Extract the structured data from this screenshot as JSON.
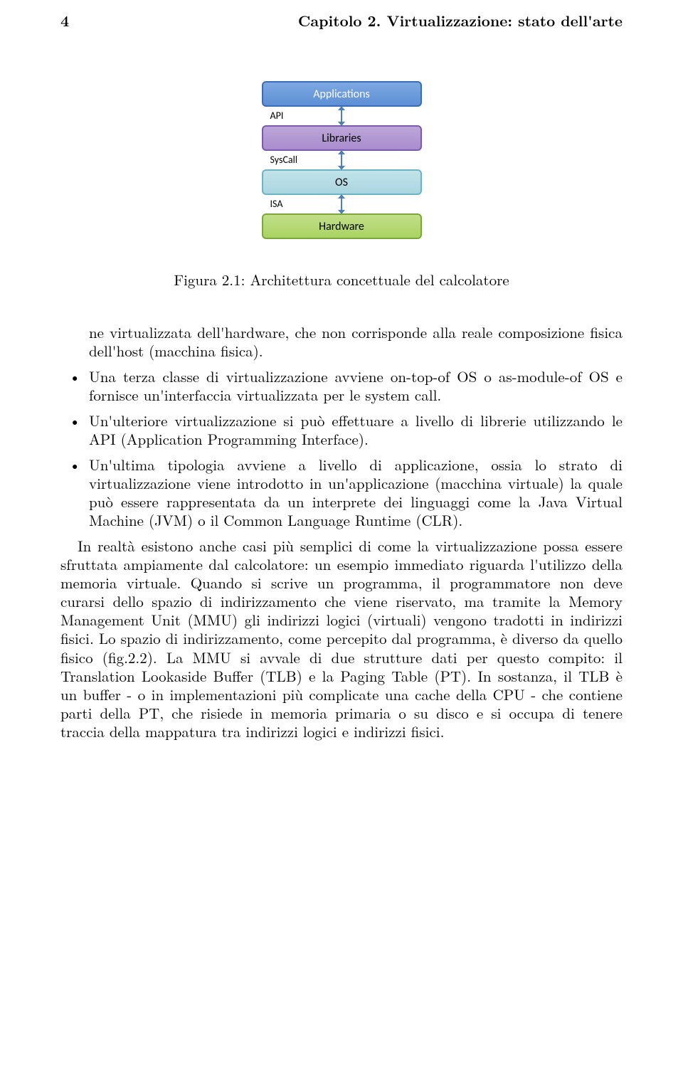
{
  "header": {
    "page_number": "4",
    "running_title": "Capitolo 2. Virtualizzazione: stato dell'arte"
  },
  "figure": {
    "boxes": {
      "applications": "Applications",
      "libraries": "Libraries",
      "os": "OS",
      "hardware": "Hardware"
    },
    "connectors": {
      "api": "API",
      "syscall": "SysCall",
      "isa": "ISA"
    },
    "caption": "Figura 2.1: Architettura concettuale del calcolatore"
  },
  "intro_fragment": "ne virtualizzata dell'hardware, che non corrisponde alla reale composizione fisica dell'host (macchina fisica).",
  "bullets": [
    "Una terza classe di virtualizzazione avviene on-top-of OS o as-module-of OS e fornisce un'interfaccia virtualizzata per le system call.",
    "Un'ulteriore virtualizzazione si può effettuare a livello di librerie utilizzando le API (Application Programming Interface).",
    "Un'ultima tipologia avviene a livello di applicazione, ossia lo strato di virtualizzazione viene introdotto in un'applicazione (macchina virtuale) la quale può essere rappresentata da un interprete dei linguaggi come la Java Virtual Machine (JVM) o il Common Language Runtime (CLR)."
  ],
  "paragraph": "In realtà esistono anche casi più semplici di come la virtualizzazione possa essere sfruttata ampiamente dal calcolatore: un esempio immediato riguarda l'utilizzo della memoria virtuale. Quando si scrive un programma, il programmatore non deve curarsi dello spazio di indirizzamento che viene riservato, ma tramite la Memory Management Unit (MMU) gli indirizzi logici (virtuali) vengono tradotti in indirizzi fisici. Lo spazio di indirizzamento, come percepito dal programma, è diverso da quello fisico (fig.2.2). La MMU si avvale di due strutture dati per questo compito: il Translation Lookaside Buffer (TLB) e la Paging Table (PT). In sostanza, il TLB è un buffer - o in implementazioni più complicate una cache della CPU - che contiene parti della PT, che risiede in memoria primaria o su disco e si occupa di tenere traccia della mappatura tra indirizzi logici e indirizzi fisici."
}
